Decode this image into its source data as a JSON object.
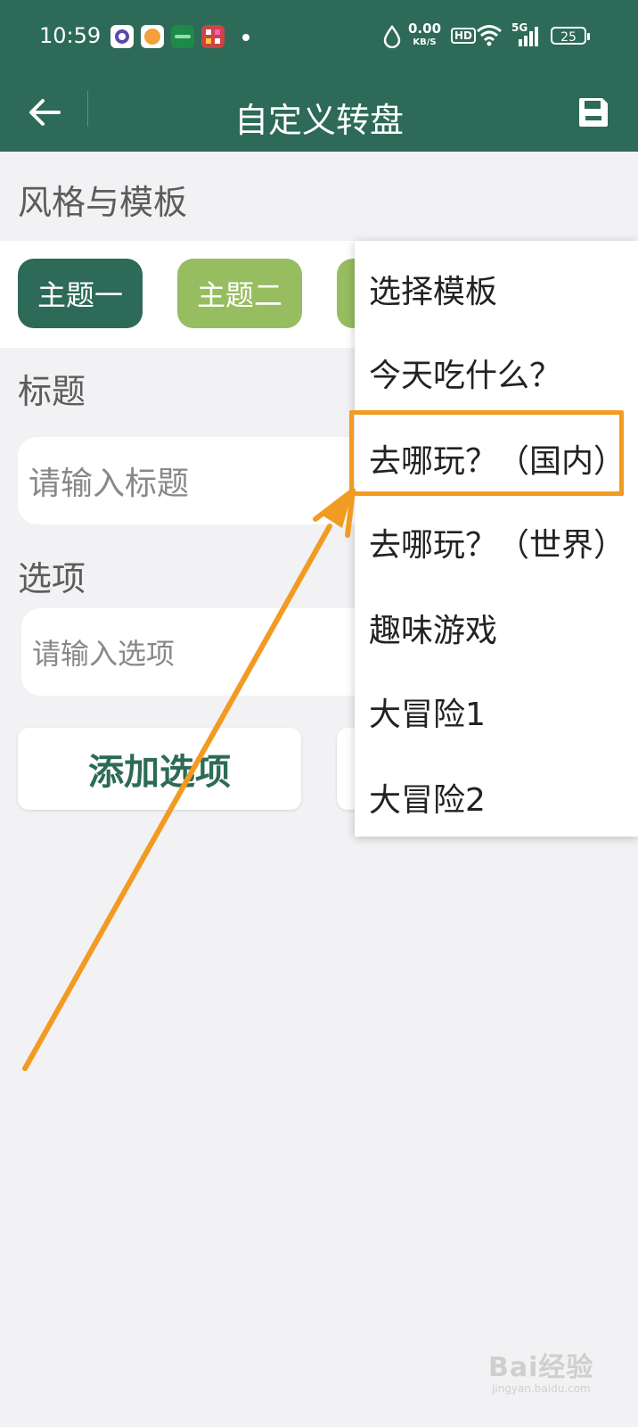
{
  "status_bar": {
    "time": "10:59",
    "net_speed_value": "0.00",
    "net_speed_unit": "KB/S",
    "hd_label": "HD",
    "signal_label": "5G",
    "battery_level": "25"
  },
  "toolbar": {
    "title": "自定义转盘"
  },
  "style_section": {
    "label": "风格与模板",
    "themes": [
      "主题一",
      "主题二"
    ]
  },
  "title_section": {
    "label": "标题",
    "input_placeholder": "请输入标题"
  },
  "options_section": {
    "label": "选项",
    "input_placeholder": "请输入选项",
    "add_button_label": "添加选项"
  },
  "template_menu": {
    "items": [
      "选择模板",
      "今天吃什么？",
      "去哪玩？（国内）",
      "去哪玩？（世界）",
      "趣味游戏",
      "大冒险1",
      "大冒险2"
    ],
    "highlighted_index": 2
  },
  "watermark": {
    "brand": "Bai经验",
    "url": "jingyan.baidu.com"
  },
  "colors": {
    "primary": "#2d6a58",
    "theme_two": "#96bd5f",
    "annotation": "#f29b22"
  }
}
